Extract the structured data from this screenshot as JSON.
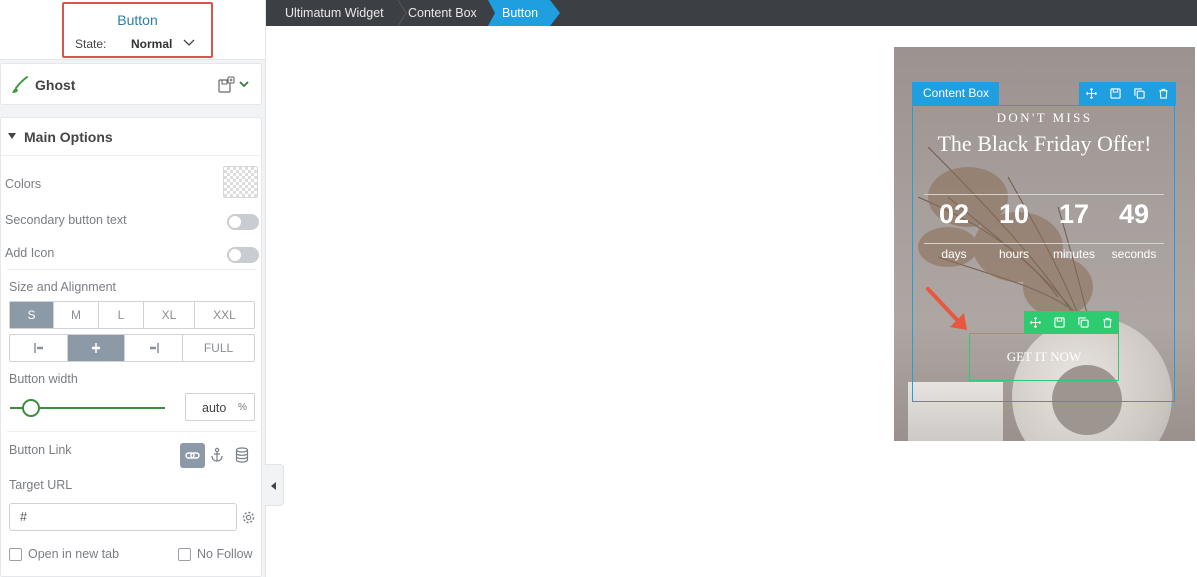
{
  "panel": {
    "header": {
      "title": "Button",
      "state_label": "State:",
      "state_value": "Normal"
    },
    "preset": {
      "name": "Ghost"
    },
    "main_options": {
      "title": "Main Options",
      "colors_label": "Colors",
      "secondary_text_label": "Secondary button text",
      "add_icon_label": "Add Icon",
      "size_alignment_label": "Size and Alignment",
      "sizes": [
        "S",
        "M",
        "L",
        "XL",
        "XXL"
      ],
      "size_selected": "S",
      "alignments": [
        {
          "icon": "align-left-icon"
        },
        {
          "icon": "align-center-icon"
        },
        {
          "icon": "align-right-icon"
        },
        {
          "label": "FULL"
        }
      ],
      "alignment_selected": "align-center-icon",
      "button_width_label": "Button width",
      "button_width_value": "auto",
      "button_width_unit": "%",
      "button_link_label": "Button Link",
      "target_url_label": "Target URL",
      "target_url_value": "#",
      "open_new_tab_label": "Open in new tab",
      "no_follow_label": "No Follow"
    }
  },
  "breadcrumb": {
    "items": [
      "Ultimatum Widget",
      "Content Box"
    ],
    "active": "Button"
  },
  "preview": {
    "content_box_label": "Content Box",
    "eyebrow": "DON'T MISS",
    "headline": "The Black Friday Offer!",
    "countdown": [
      {
        "value": "02",
        "unit": "days"
      },
      {
        "value": "10",
        "unit": "hours"
      },
      {
        "value": "17",
        "unit": "minutes"
      },
      {
        "value": "49",
        "unit": "seconds"
      }
    ],
    "button_text": "GET IT NOW"
  },
  "colors": {
    "accent_blue": "#1f9ee0",
    "selection_green": "#2ecc71",
    "highlight_red": "#d9534f",
    "slider_green": "#3d8b3d",
    "breadcrumb_bg": "#3c3f44"
  }
}
